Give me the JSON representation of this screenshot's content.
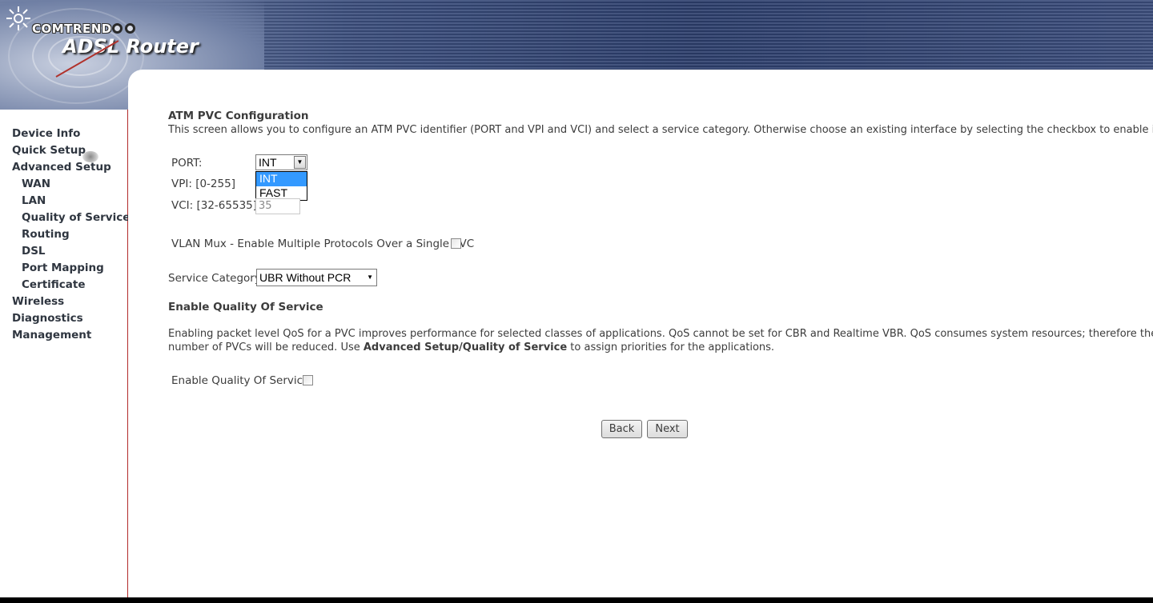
{
  "header": {
    "brand": "COMTREND",
    "product": "ADSL Router"
  },
  "sidebar": {
    "items": [
      {
        "label": "Device Info",
        "level": 0
      },
      {
        "label": "Quick Setup",
        "level": 0
      },
      {
        "label": "Advanced Setup",
        "level": 0
      },
      {
        "label": "WAN",
        "level": 1
      },
      {
        "label": "LAN",
        "level": 1
      },
      {
        "label": "Quality of Service",
        "level": 1
      },
      {
        "label": "Routing",
        "level": 1
      },
      {
        "label": "DSL",
        "level": 1
      },
      {
        "label": "Port Mapping",
        "level": 1
      },
      {
        "label": "Certificate",
        "level": 1
      },
      {
        "label": "Wireless",
        "level": 0
      },
      {
        "label": "Diagnostics",
        "level": 0
      },
      {
        "label": "Management",
        "level": 0
      }
    ]
  },
  "atm": {
    "title": "ATM PVC Configuration",
    "description": "This screen allows you to configure an ATM PVC identifier (PORT and VPI and VCI) and select a service category. Otherwise choose an existing interface by selecting the checkbox to enable it.",
    "port_label": "PORT:",
    "port_value": "INT",
    "port_options": [
      "INT",
      "FAST"
    ],
    "vpi_label": "VPI: [0-255]",
    "vci_label": "VCI: [32-65535]",
    "vci_value": "35",
    "vlan_label": "VLAN Mux - Enable Multiple Protocols Over a Single PVC",
    "service_category_label": "Service Category:",
    "service_category_value": "UBR Without PCR"
  },
  "qos": {
    "title": "Enable Quality Of Service",
    "desc_line1": "Enabling packet level QoS for a PVC improves performance for selected classes of applications.  QoS cannot be set for CBR and Realtime VBR.  QoS consumes system resources; therefore the",
    "desc_line2_a": "number of PVCs will be reduced. Use ",
    "desc_line2_link": "Advanced Setup/Quality of Service",
    "desc_line2_b": " to assign priorities for the applications.",
    "enable_label": "Enable Quality Of Service"
  },
  "buttons": {
    "back": "Back",
    "next": "Next"
  }
}
